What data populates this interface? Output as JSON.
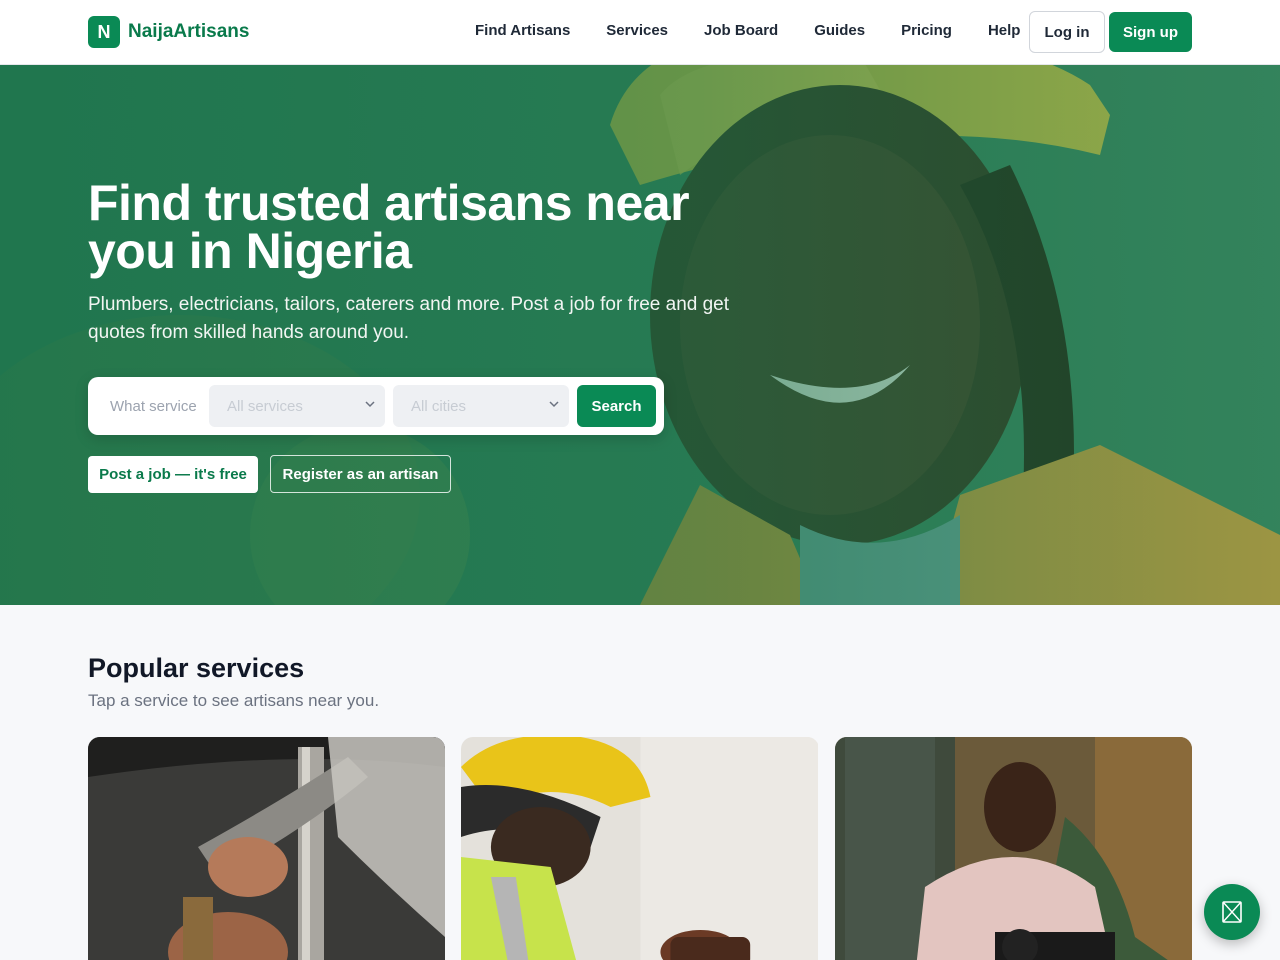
{
  "brand": {
    "logo_letter": "N",
    "name": "NaijaArtisans",
    "accent": "#0a8a55"
  },
  "nav": {
    "items": [
      {
        "label": "Find Artisans"
      },
      {
        "label": "Services"
      },
      {
        "label": "Job Board"
      },
      {
        "label": "Guides"
      },
      {
        "label": "Pricing"
      },
      {
        "label": "Help"
      }
    ],
    "login_label": "Log in",
    "signup_label": "Sign up"
  },
  "hero": {
    "title": "Find trusted artisans near you in Nigeria",
    "subtitle": "Plumbers, electricians, tailors, caterers and more. Post a job for free and get quotes from skilled hands around you.",
    "search": {
      "placeholder": "What service do you need?",
      "service_select": "All services",
      "city_select": "All cities",
      "button_label": "Search"
    },
    "post_job_label": "Post a job — it's free",
    "register_label": "Register as an artisan"
  },
  "services_section": {
    "title": "Popular services",
    "subtitle": "Tap a service to see artisans near you.",
    "cards": [
      {
        "image": "plumber-photo"
      },
      {
        "image": "electrician-photo"
      },
      {
        "image": "tailor-photo"
      }
    ]
  },
  "chat": {
    "icon": "chat-icon"
  }
}
